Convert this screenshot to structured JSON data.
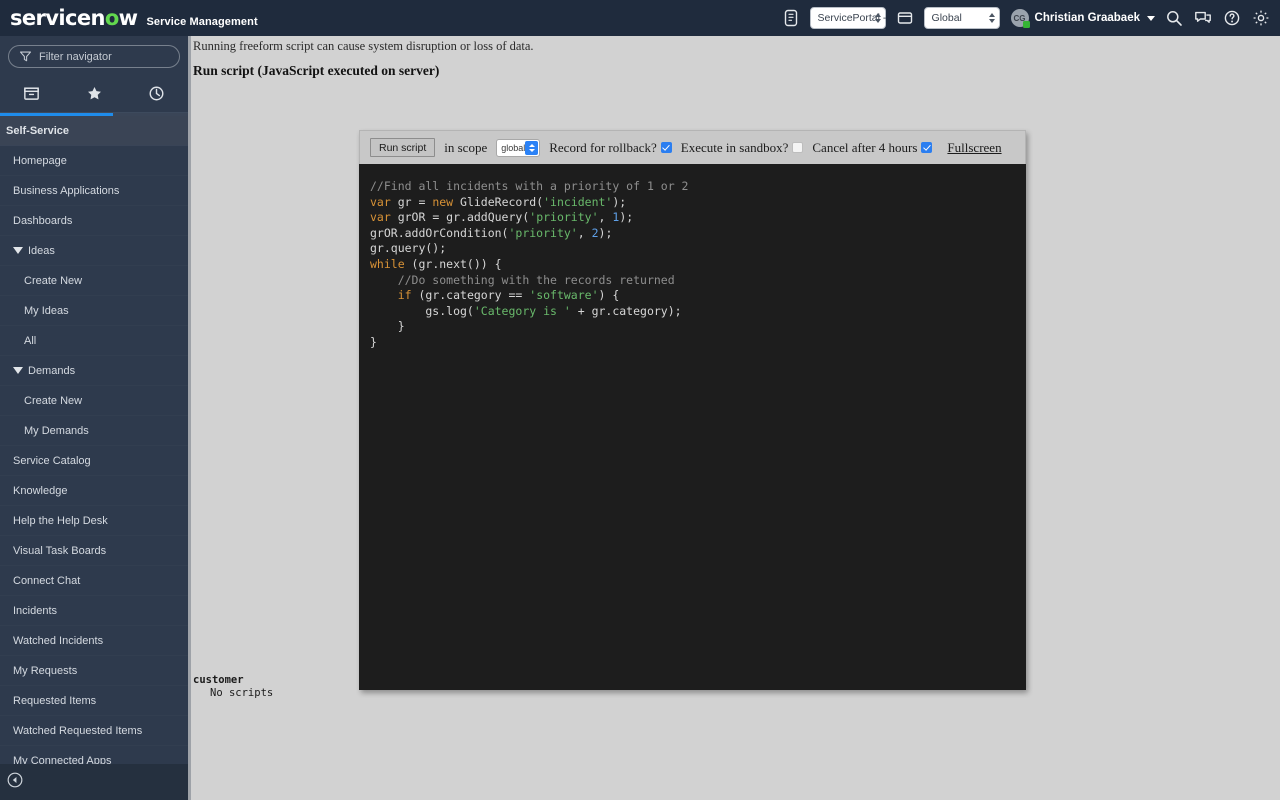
{
  "banner": {
    "logo": "servicenow",
    "logo_prefix": "servicen",
    "logo_o": "o",
    "logo_suffix": "w",
    "subtitle": "Service Management",
    "app_selector": "ServicePortal -",
    "domain_selector": "Global",
    "user_initials": "CG",
    "user_name": "Christian Graabaek",
    "icons": [
      "document-icon",
      "window-icon",
      "search-icon",
      "chat-icon",
      "help-icon",
      "gear-icon"
    ],
    "accent_color": "#1f8ceb",
    "background_color": "#1f2b3d"
  },
  "sidebar": {
    "filter_placeholder": "Filter navigator",
    "tabs": [
      {
        "name": "all-applications",
        "icon": "box-icon"
      },
      {
        "name": "favorites",
        "icon": "star-icon"
      },
      {
        "name": "history",
        "icon": "clock-icon"
      }
    ],
    "section": "Self-Service",
    "items": [
      {
        "label": "Homepage",
        "type": "item"
      },
      {
        "label": "Business Applications",
        "type": "item"
      },
      {
        "label": "Dashboards",
        "type": "item"
      },
      {
        "label": "Ideas",
        "type": "group"
      },
      {
        "label": "Create New",
        "type": "child"
      },
      {
        "label": "My Ideas",
        "type": "child"
      },
      {
        "label": "All",
        "type": "child"
      },
      {
        "label": "Demands",
        "type": "group"
      },
      {
        "label": "Create New",
        "type": "child"
      },
      {
        "label": "My Demands",
        "type": "child"
      },
      {
        "label": "Service Catalog",
        "type": "item"
      },
      {
        "label": "Knowledge",
        "type": "item"
      },
      {
        "label": "Help the Help Desk",
        "type": "item"
      },
      {
        "label": "Visual Task Boards",
        "type": "item"
      },
      {
        "label": "Connect Chat",
        "type": "item"
      },
      {
        "label": "Incidents",
        "type": "item"
      },
      {
        "label": "Watched Incidents",
        "type": "item"
      },
      {
        "label": "My Requests",
        "type": "item"
      },
      {
        "label": "Requested Items",
        "type": "item"
      },
      {
        "label": "Watched Requested Items",
        "type": "item"
      },
      {
        "label": "My Connected Apps",
        "type": "item"
      }
    ],
    "collapse_icon": "collapse-left-icon"
  },
  "content": {
    "warning": "Running freeform script can cause system disruption or loss of data.",
    "title": "Run script (JavaScript executed on server)"
  },
  "editor": {
    "run_button": "Run script",
    "scope_label": "in scope",
    "scope_value": "global",
    "rollback_label": "Record for rollback?",
    "rollback_checked": true,
    "sandbox_label": "Execute in sandbox?",
    "sandbox_checked": false,
    "cancel_label": "Cancel after 4 hours",
    "cancel_checked": true,
    "fullscreen_label": "Fullscreen",
    "code_lines": [
      [
        {
          "t": "//Find all incidents with a priority of 1 or 2",
          "c": "c-com"
        }
      ],
      [
        {
          "t": "var",
          "c": "c-kw"
        },
        {
          "t": " gr = ",
          "c": "c-pln"
        },
        {
          "t": "new",
          "c": "c-kw"
        },
        {
          "t": " GlideRecord(",
          "c": "c-pln"
        },
        {
          "t": "'incident'",
          "c": "c-str"
        },
        {
          "t": ");",
          "c": "c-pln"
        }
      ],
      [
        {
          "t": "var",
          "c": "c-kw"
        },
        {
          "t": " grOR = gr.addQuery(",
          "c": "c-pln"
        },
        {
          "t": "'priority'",
          "c": "c-str"
        },
        {
          "t": ", ",
          "c": "c-pln"
        },
        {
          "t": "1",
          "c": "c-num"
        },
        {
          "t": ");",
          "c": "c-pln"
        }
      ],
      [
        {
          "t": "grOR.addOrCondition(",
          "c": "c-pln"
        },
        {
          "t": "'priority'",
          "c": "c-str"
        },
        {
          "t": ", ",
          "c": "c-pln"
        },
        {
          "t": "2",
          "c": "c-num"
        },
        {
          "t": ");",
          "c": "c-pln"
        }
      ],
      [
        {
          "t": "gr.query();",
          "c": "c-pln"
        }
      ],
      [
        {
          "t": "while",
          "c": "c-kw"
        },
        {
          "t": " (gr.next()) {",
          "c": "c-pln"
        }
      ],
      [
        {
          "t": "    //Do something with the records returned",
          "c": "c-com"
        }
      ],
      [
        {
          "t": "    ",
          "c": "c-pln"
        },
        {
          "t": "if",
          "c": "c-kw"
        },
        {
          "t": " (gr.category == ",
          "c": "c-pln"
        },
        {
          "t": "'software'",
          "c": "c-str"
        },
        {
          "t": ") {",
          "c": "c-pln"
        }
      ],
      [
        {
          "t": "        gs.log(",
          "c": "c-pln"
        },
        {
          "t": "'Category is '",
          "c": "c-str"
        },
        {
          "t": " + gr.category);",
          "c": "c-pln"
        }
      ],
      [
        {
          "t": "    }",
          "c": "c-pln"
        }
      ],
      [
        {
          "t": "}",
          "c": "c-pln"
        }
      ]
    ]
  },
  "output": {
    "title": "customer",
    "body": "No scripts"
  }
}
